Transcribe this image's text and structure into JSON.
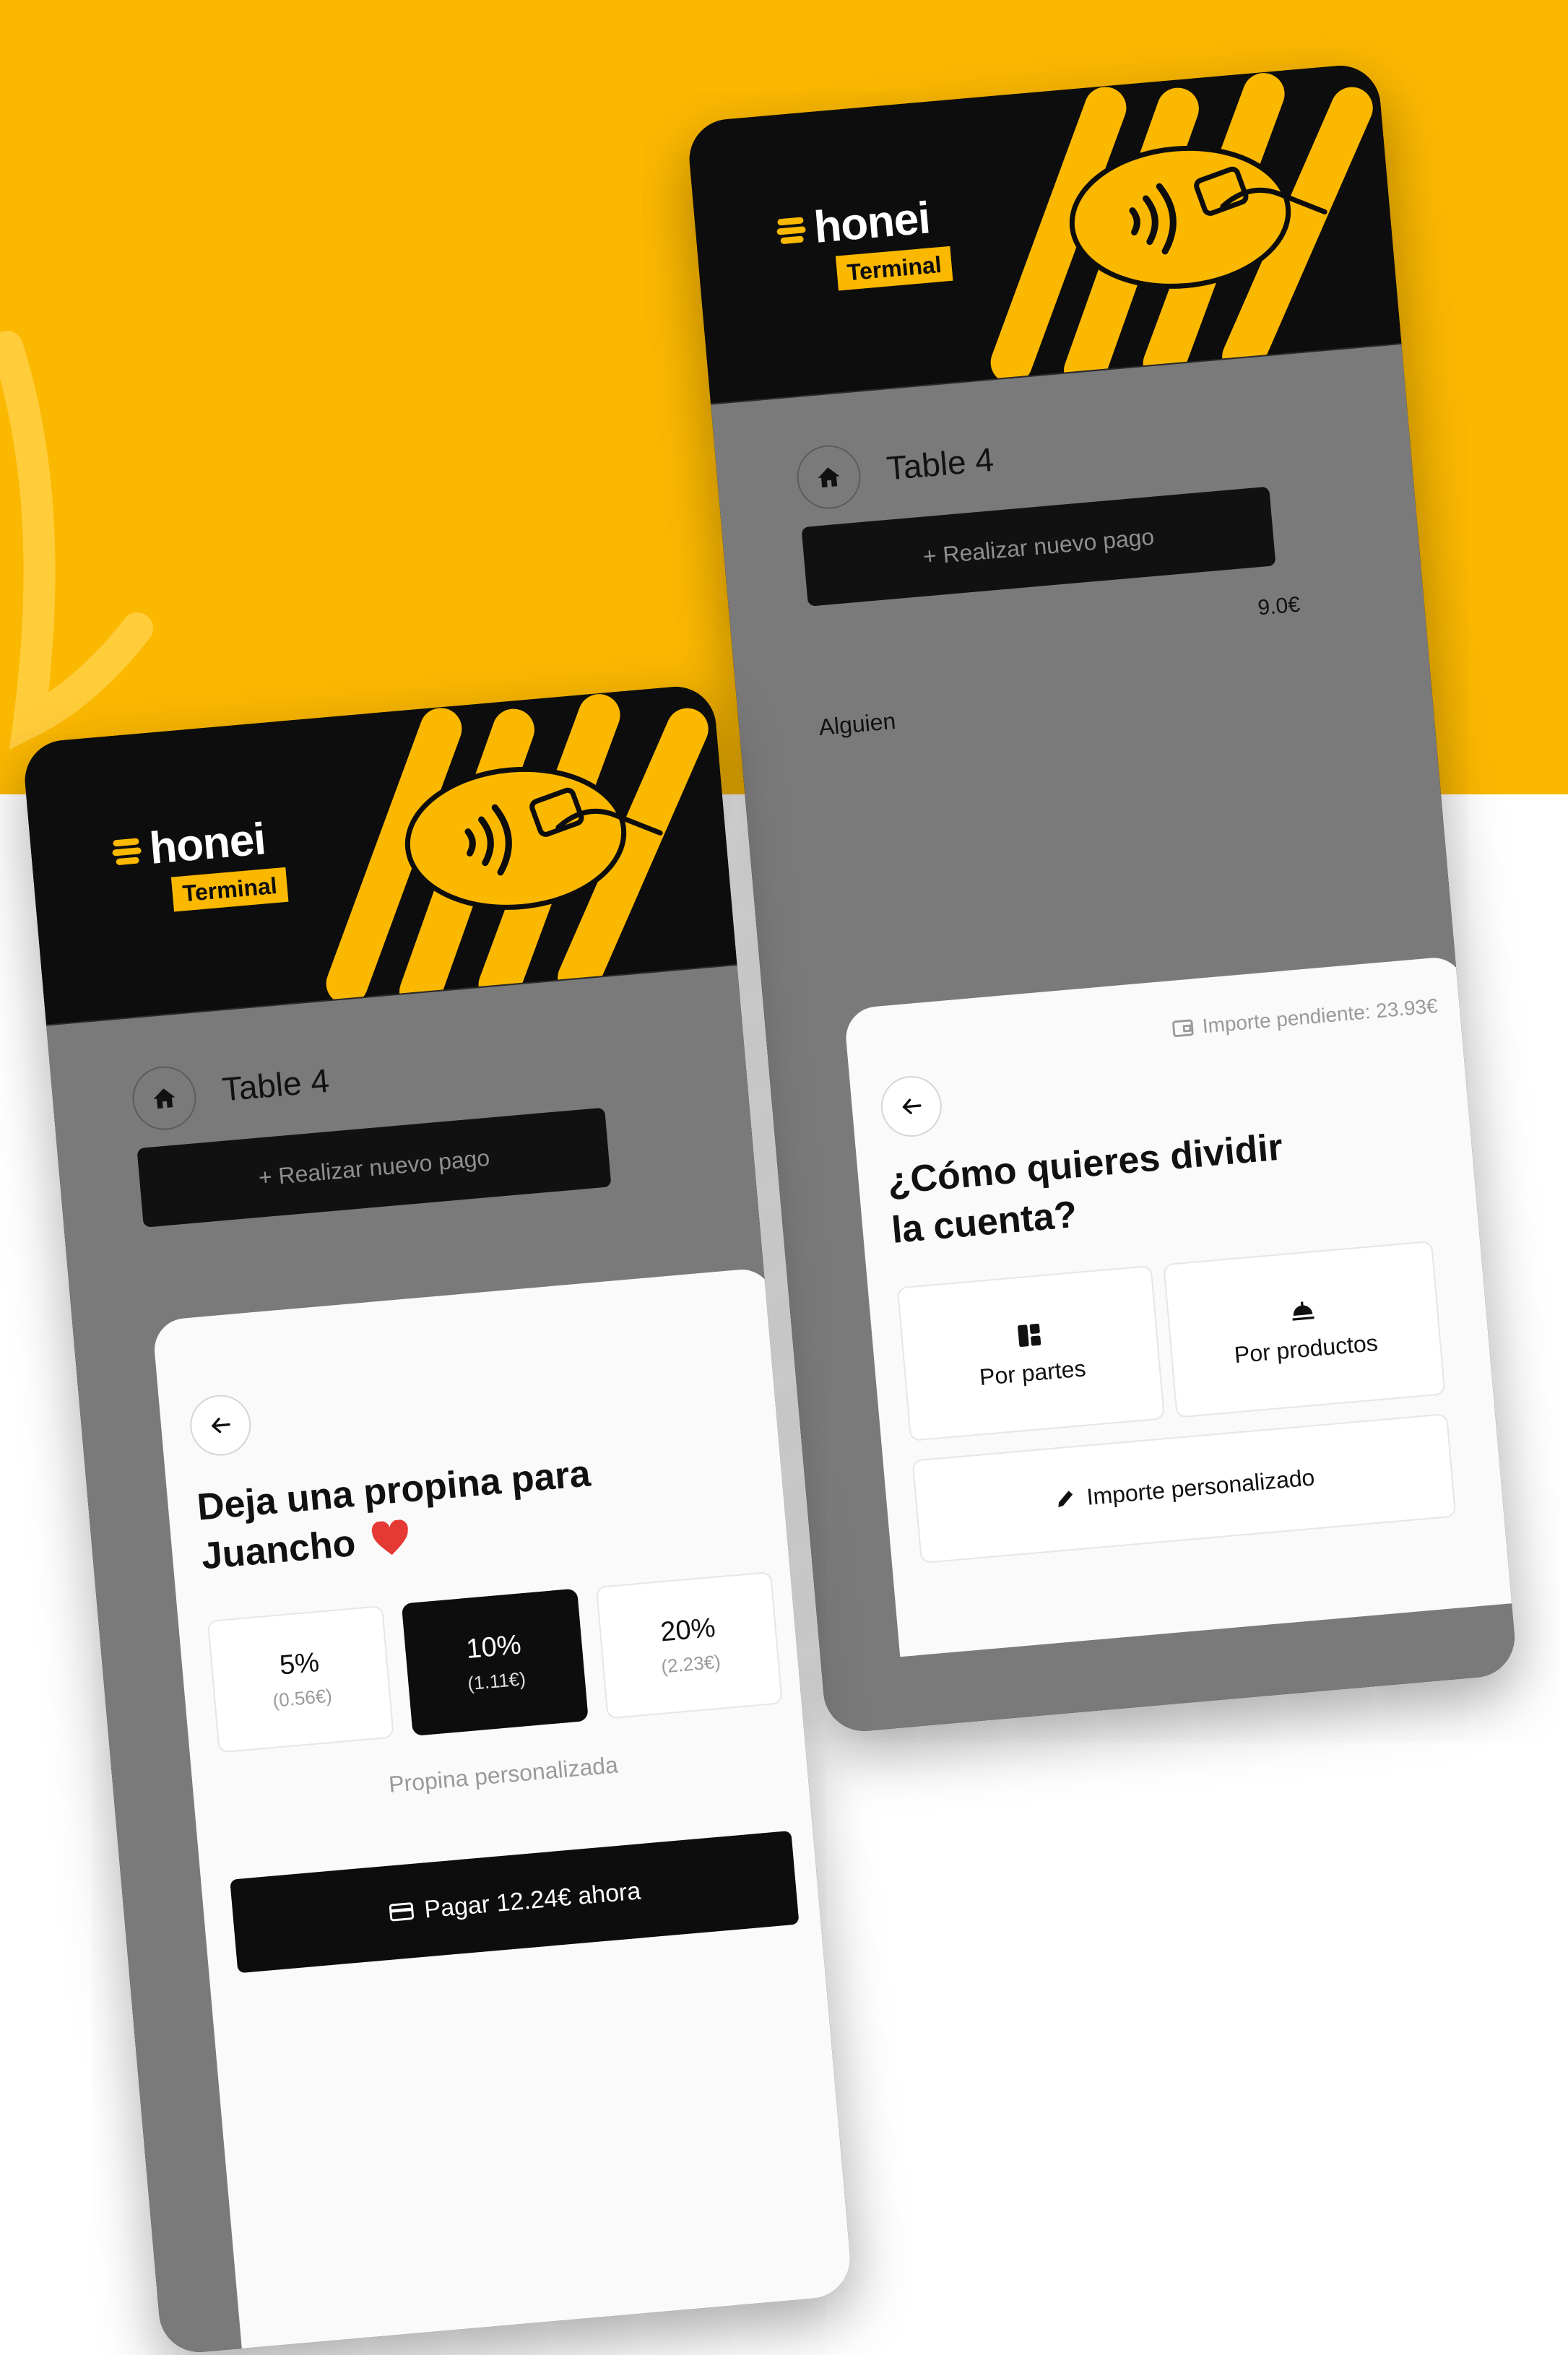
{
  "brand": {
    "name": "honei",
    "badge": "Terminal"
  },
  "colors": {
    "brand_yellow": "#fbb800",
    "dark": "#0d0d0d",
    "overlay_grey": "#7a7a7a",
    "sheet_bg": "#fafafa"
  },
  "split_screen": {
    "table_title": "Table 4",
    "new_payment_label": "+ Realizar nuevo pago",
    "amount": "9.0€",
    "payer_name": "Alguien",
    "sheet": {
      "pending_label": "Importe pendiente: 23.93€",
      "title_line1": "¿Cómo quieres dividir",
      "title_line2": "la cuenta?",
      "options": {
        "by_parts": "Por partes",
        "by_products": "Por productos",
        "custom_amount": "Importe personalizado"
      }
    }
  },
  "tip_screen": {
    "table_title": "Table 4",
    "new_payment_label": "+ Realizar nuevo pago",
    "sheet": {
      "title_line1": "Deja una propina para",
      "title_line2": "Juancho",
      "heart_icon": "heart-emoji",
      "tips": [
        {
          "percent": "5%",
          "amount": "(0.56€)"
        },
        {
          "percent": "10%",
          "amount": "(1.11€)"
        },
        {
          "percent": "20%",
          "amount": "(2.23€)"
        }
      ],
      "selected_tip": "10%",
      "custom_tip_label": "Propina personalizada",
      "pay_button_label": "Pagar 12.24€ ahora"
    }
  }
}
